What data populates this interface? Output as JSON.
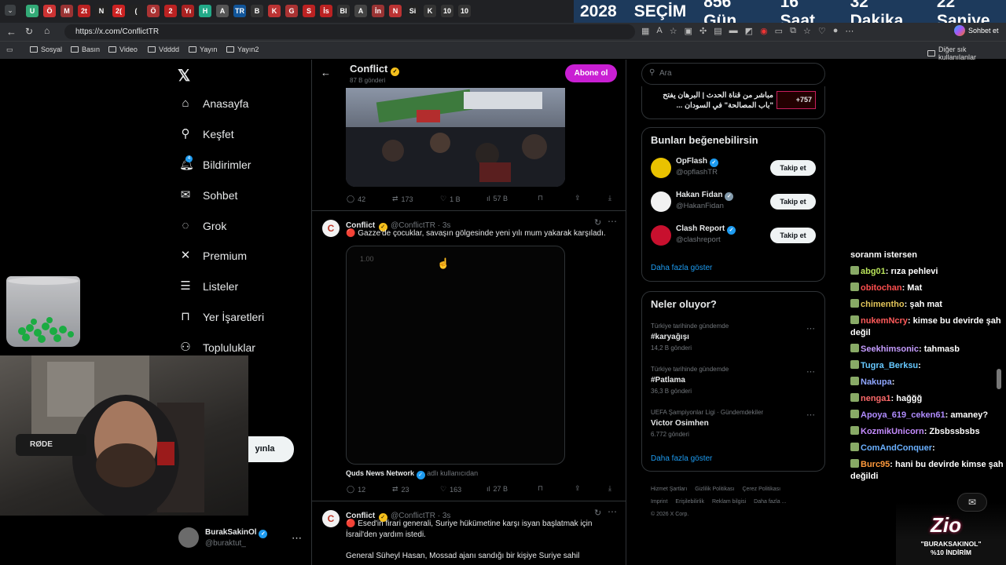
{
  "browser": {
    "url": "https://x.com/ConflictTR",
    "tab_icons": [
      "U",
      "Ö",
      "M",
      "2t",
      "N",
      "2(",
      "(",
      "Ö",
      "2",
      "Yı",
      "H",
      "A",
      "TR",
      "B",
      "K",
      "G",
      "S",
      "İs",
      "Bl",
      "A",
      "İn",
      "N",
      "Si",
      "K",
      "10",
      "10"
    ],
    "countdown": {
      "year": "2028",
      "label": "SEÇİM",
      "days": "856 Gün",
      "hours": "16 Saat",
      "minutes": "32 Dakika",
      "seconds": "22 Saniye"
    },
    "copilot_label": "Sohbet et",
    "bookmarks": [
      "Sosyal",
      "Basın",
      "Video",
      "Vdddd",
      "Yayın",
      "Yayın2"
    ],
    "other_bookmarks": "Diğer sık kullanılanlar"
  },
  "nav": {
    "items": [
      {
        "label": "Anasayfa",
        "icon": "home-icon"
      },
      {
        "label": "Keşfet",
        "icon": "search-icon"
      },
      {
        "label": "Bildirimler",
        "icon": "bell-icon",
        "badge": "4"
      },
      {
        "label": "Sohbet",
        "icon": "mail-icon"
      },
      {
        "label": "Grok",
        "icon": "grok-icon"
      },
      {
        "label": "Premium",
        "icon": "x-icon"
      },
      {
        "label": "Listeler",
        "icon": "list-icon"
      },
      {
        "label": "Yer İşaretleri",
        "icon": "bookmark-icon"
      },
      {
        "label": "Topluluklar",
        "icon": "people-icon"
      }
    ],
    "partial_label": "a",
    "post_button": "yınla",
    "account": {
      "name": "BurakSakinOl",
      "handle": "@buraktut_"
    }
  },
  "profile": {
    "name": "Conflict",
    "posts_count": "87 B gönderi",
    "subscribe": "Abone ol"
  },
  "tweets": [
    {
      "actions": {
        "replies": "42",
        "reposts": "173",
        "likes": "1 B",
        "views": "57 B"
      }
    },
    {
      "name": "Conflict",
      "handle": "@ConflictTR · 3s",
      "text": "🔴 Gazze'de çocuklar, savaşın gölgesinde yeni yılı mum yakarak karşıladı.",
      "video_time": "1.00",
      "source_name": "Quds News Network",
      "source_suffix": "adlı kullanıcıdan",
      "actions": {
        "replies": "12",
        "reposts": "23",
        "likes": "163",
        "views": "27 B"
      }
    },
    {
      "name": "Conflict",
      "handle": "@ConflictTR · 3s",
      "text": "🔴 Esed'in firari generali, Suriye hükümetine karşı isyan başlatmak için İsrail'den yardım istedi.",
      "text2": "General Süheyl Hasan, Mossad ajanı sandığı bir kişiye Suriye sahil"
    }
  ],
  "right": {
    "search_placeholder": "Ara",
    "live": {
      "text": "مباشر من قناة الحدث | البرهان يفتح \"باب المصالحة\" في السودان ...",
      "count": "+757"
    },
    "suggest_title": "Bunları beğenebilirsin",
    "suggestions": [
      {
        "name": "OpFlash",
        "handle": "@opflashTR",
        "follow": "Takip et"
      },
      {
        "name": "Hakan Fidan",
        "handle": "@HakanFidan",
        "follow": "Takip et"
      },
      {
        "name": "Clash Report",
        "handle": "@clashreport",
        "follow": "Takip et"
      }
    ],
    "show_more": "Daha fazla göster",
    "trends_title": "Neler oluyor?",
    "trends": [
      {
        "meta": "Türkiye tarihinde gündemde",
        "name": "#karyağışı",
        "count": "14,2 B gönderi"
      },
      {
        "meta": "Türkiye tarihinde gündemde",
        "name": "#Patlama",
        "count": "36,3 B gönderi"
      },
      {
        "meta": "UEFA Şampiyonlar Ligi · Gündemdekiler",
        "name": "Victor Osimhen",
        "count": "6.772 gönderi"
      }
    ],
    "trends_more": "Daha fazla göster",
    "footer": [
      "Hizmet Şartları",
      "Gizlilik Politikası",
      "Çerez Politikası",
      "Imprint",
      "Erişilebilirlik",
      "Reklam bilgisi",
      "Daha fazla ...",
      "© 2026 X Corp."
    ]
  },
  "chat": [
    {
      "user": "",
      "msg": "soranm istersen",
      "color": "#ffffff"
    },
    {
      "user": "abg01",
      "msg": "rıza pehlevi",
      "color": "#b9e35a"
    },
    {
      "user": "obitochan",
      "msg": "Mat",
      "color": "#ff4f4f"
    },
    {
      "user": "chimentho",
      "msg": "şah mat",
      "color": "#e3c55a"
    },
    {
      "user": "nukemNcry",
      "msg": "kimse bu devirde şah değil",
      "color": "#ff5a5a"
    },
    {
      "user": "Seekhimsonic",
      "msg": "tahmasb",
      "color": "#c59cff"
    },
    {
      "user": "Tugra_Berksu",
      "msg": "",
      "color": "#66c8ff"
    },
    {
      "user": "Nakupa",
      "msg": "",
      "color": "#8fa6ff"
    },
    {
      "user": "nenga1",
      "msg": "hağğğ",
      "color": "#ff6a6a"
    },
    {
      "user": "Apoya_619_ceken61",
      "msg": "amaney?",
      "color": "#b08cff"
    },
    {
      "user": "KozmikUnicorn",
      "msg": "Zbsbssbsbs",
      "color": "#c58cff"
    },
    {
      "user": "ComAndConquer",
      "msg": "",
      "color": "#6ab0ff"
    },
    {
      "user": "Burc95",
      "msg": "hani bu devirde kimse şah değildi",
      "color": "#ff9a3c"
    }
  ],
  "promo": {
    "logo": "Zio",
    "line1": "\"BURAKSAKINOL\"",
    "line2": "%10 İNDİRİM"
  },
  "webcam": {
    "mic_label": "RØDE"
  },
  "colors": {
    "verified": "#f4bf1c",
    "subscribe": "#c91fd3",
    "link": "#1d9bf0"
  }
}
